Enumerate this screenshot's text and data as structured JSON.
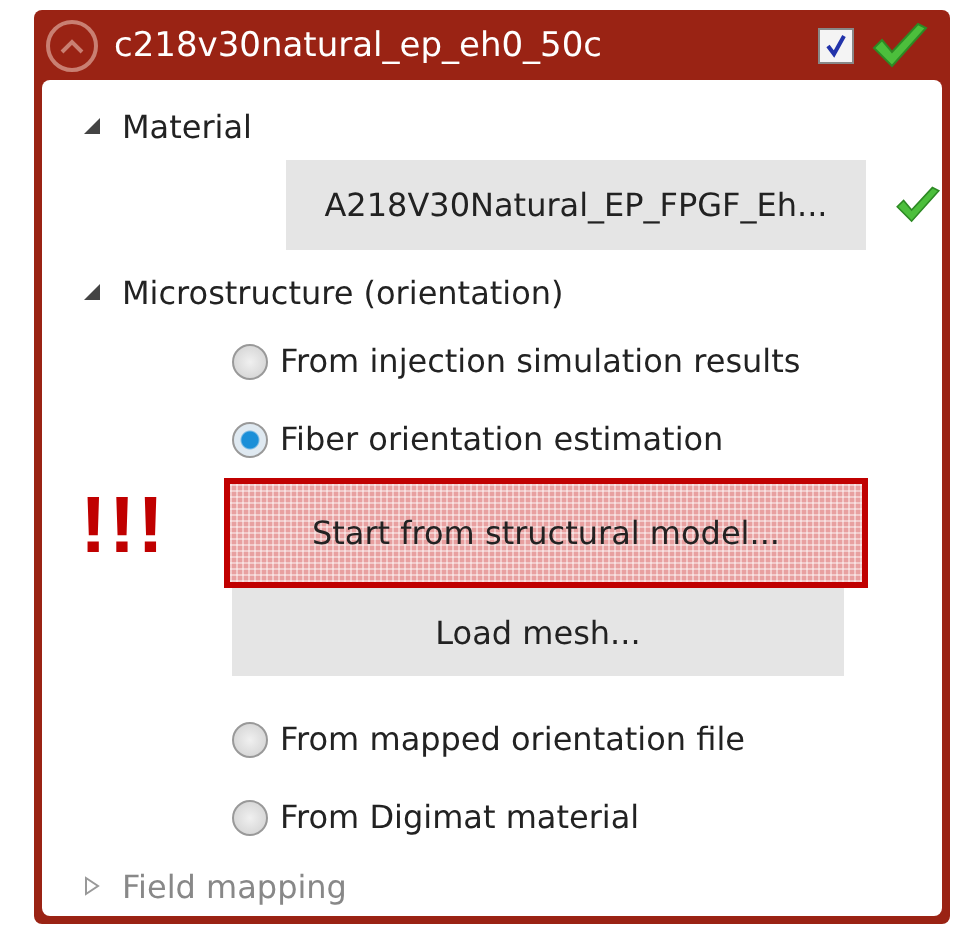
{
  "panel": {
    "title": "c218v30natural_ep_eh0_50c",
    "collapsed": false,
    "checked": true,
    "valid": true
  },
  "sections": [
    {
      "label": "Material",
      "expanded": true,
      "disabled": false,
      "items": [
        {
          "kind": "value",
          "text": "A218V30Natural_EP_FPGF_Eh...",
          "valid": true
        }
      ]
    },
    {
      "label": "Microstructure (orientation)",
      "expanded": true,
      "disabled": false,
      "items": [
        {
          "kind": "radio",
          "text": "From injection simulation results",
          "selected": false
        },
        {
          "kind": "radio",
          "text": "Fiber orientation estimation",
          "selected": true
        },
        {
          "kind": "button",
          "text": "Start from structural model...",
          "highlighted": true,
          "warning": "!!!"
        },
        {
          "kind": "button",
          "text": "Load mesh...",
          "highlighted": false
        },
        {
          "kind": "radio",
          "text": "From mapped orientation file",
          "selected": false
        },
        {
          "kind": "radio",
          "text": "From Digimat material",
          "selected": false
        }
      ]
    },
    {
      "label": "Field mapping",
      "expanded": false,
      "disabled": true
    }
  ]
}
